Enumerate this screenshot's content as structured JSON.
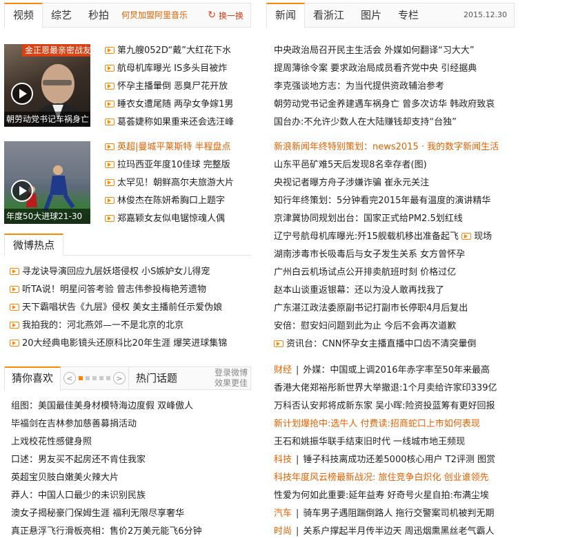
{
  "left_tabs": {
    "tabs": [
      "视频",
      "综艺",
      "秒拍"
    ],
    "promo": "何炅加盟阿里音乐",
    "refresh": "换一换"
  },
  "right_tabs": {
    "tabs": [
      "新闻",
      "看浙江",
      "图片",
      "专栏"
    ],
    "date": "2015.12.30"
  },
  "video1": {
    "top_caption": "金正恩最亲密战友",
    "caption": "朝劳动党书记车祸身亡",
    "items": [
      "第九艘052D“戴”大红花下水",
      "航母机库曝光 IS多头目被炸",
      "怀孕主播暈倒 恶臭尸花开放",
      "睡衣女遭尾随 两孕女争嫁1男",
      "葛荟婕称如果重来还会选汪峰"
    ]
  },
  "video2": {
    "caption": "年度50大进球21-30",
    "items": [
      {
        "pre": "英超|",
        "link": "曼城平莱斯特",
        "post": " 半程盘点",
        "orange": true
      },
      {
        "text": "拉玛西亚年度10佳球 完整版"
      },
      {
        "text": "太罕见！朝鲜高尔夫旅游大片"
      },
      {
        "text": "林俊杰在陈妍希胸口上题字"
      },
      {
        "text": "郑嘉颖女友似电锯惊魂人偶"
      }
    ]
  },
  "weibo": {
    "title": "微博热点",
    "items": [
      "寻龙诀导演回应九层妖塔侵权 小S嫉妒女儿得宠",
      "听TA说！明星问答考验 曾志伟参投梅艳芳遗物",
      "天下霸唱状告《九层》侵权 美女主播前任示爱伪娘",
      "我拍我的：河北燕郊—一不是北京的北京",
      "20大经典电影镜头还原科比20年生涯 爆笑进球集锦"
    ]
  },
  "guess": {
    "tab1": "猜你喜欢",
    "tab2": "热门话题",
    "side": [
      "登录微博",
      "效果更佳"
    ],
    "prev": "<",
    "next": ">",
    "items": [
      "组图：美国最佳美身材模特海边度假 双峰傲人",
      "毕福剑在吉林参加慈善募捐活动",
      "上戏校花性感健身照",
      "口述：男友买不起房还不肯住我家",
      "英超宝贝肢白嫩美火辣大片",
      "莽人：中国人口最少的未识别民族",
      "澳女子揭秘豪门保姆生涯 福利无限尽享奢华",
      "真正悬浮飞行滑板亮相：售价2万美元能飞6分钟"
    ]
  },
  "news": {
    "group1": [
      "中央政治局召开民主生活会 外媒如何翻译“习大大”",
      "提周薄徐令案 要求政治局成员看齐党中央 引经据典",
      "李克强谈地方志：为当代提供资政辅治参考",
      "朝劳动党书记金养建遇车祸身亡 曾多次访华 韩政府致哀",
      "国台办:不允许少数人在大陆赚钱却支持“台独”"
    ],
    "group2": [
      {
        "text": "新浪新闻年终特别策划：news2015 · 我的数字新闻生活",
        "orange": true
      },
      {
        "text": "山东平邑矿难5天后发现8名幸存者(图)"
      },
      {
        "text": "央视记者曝方舟子涉嫌诈骗 崔永元关注"
      },
      {
        "text": "知行年终策划：5分钟看完2015年最有温度的演讲精华"
      },
      {
        "text": "京津冀协同规划出台：国家正式给PM2.5划红线"
      },
      {
        "text": "辽宁号航母机库曝光:歼15舰载机移出准备起飞",
        "tail": "现场"
      },
      {
        "text": "湖南涉毒市长吸毒后与女子发生关系 女方曾怀孕"
      },
      {
        "text": "广州白云机场试点公开排卖航班时刻 价格过亿"
      },
      {
        "text": "赵本山谈重返银幕：还以为没人敢再找我了"
      },
      {
        "text": "广东湛江政法委原副书记打副市长停职4月后复出"
      },
      {
        "text": "安倍：慰安妇问题到此为止 今后不会再次道歉"
      },
      {
        "text": "资讯台：CNN怀孕女主播直播中口齿不清突暈倒",
        "vid": true
      }
    ],
    "group3": [
      {
        "cat": "财经",
        "text": "外媒：中国或上调2016年赤字率至50年来最高"
      },
      {
        "text": "香港大佬郑裕彤新世界大举撤退:1个月卖给许家印339亿"
      },
      {
        "text": "万科否认安邦将成新东家 吴小晖:险资投蓝筹有更好回报"
      },
      {
        "text": "新计划爆抢中:选牛人 付费读:招商蛇口上市如何表现",
        "orange": true
      },
      {
        "text": "王石和姚振华联手结束旧时代 一线城市地王频现"
      },
      {
        "cat": "科技",
        "text": "锤子科技离成功还差5000核心用户 T2评测 图赏"
      },
      {
        "text": "科技年度风云榜最新战况: 旅住竞争白炽化 创业谁领先",
        "orange": true
      },
      {
        "text": "性爱为何如此重要:延年益寿 好奇号火星自拍:布满尘埃"
      },
      {
        "cat": "汽车",
        "text": "骑车男子遇阻踹倒路人 拖行交警案司机被判无期"
      },
      {
        "cat": "时尚",
        "text": "关系户撑起半月传半边天 周迅烟熏黑丝老气霸人"
      }
    ]
  },
  "colors": {
    "accent": "#ff8400",
    "link_orange": "#e66100",
    "refresh_red": "#e03b17"
  }
}
